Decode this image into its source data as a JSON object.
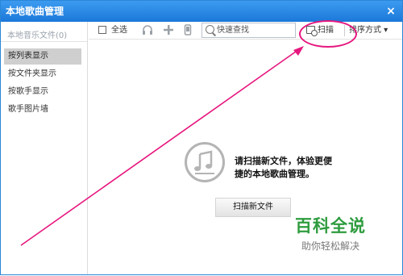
{
  "window": {
    "title": "本地歌曲管理",
    "close_glyph": "×"
  },
  "sidebar": {
    "header": "本地音乐文件(0)",
    "items": [
      {
        "label": "按列表显示",
        "active": true
      },
      {
        "label": "按文件夹显示",
        "active": false
      },
      {
        "label": "按歌手显示",
        "active": false
      },
      {
        "label": "歌手图片墙",
        "active": false
      }
    ]
  },
  "toolbar": {
    "select_all_label": "全选",
    "icons": [
      "headphones-icon",
      "plus-icon",
      "phone-icon"
    ],
    "search_placeholder": "快速查找",
    "scan_label": "扫描",
    "sort_label": "排序方式 ▾"
  },
  "main": {
    "empty_icon": "music-note-icon",
    "note_line1": "请扫描新文件，体验更便",
    "note_line2": "捷的本地歌曲管理。",
    "scan_new_button": "扫描新文件"
  },
  "annotation": {
    "color": "#e6177e"
  },
  "watermark": {
    "title": "百科全说",
    "subtitle": "助你轻松解决",
    "color": "#2e9c3e"
  }
}
